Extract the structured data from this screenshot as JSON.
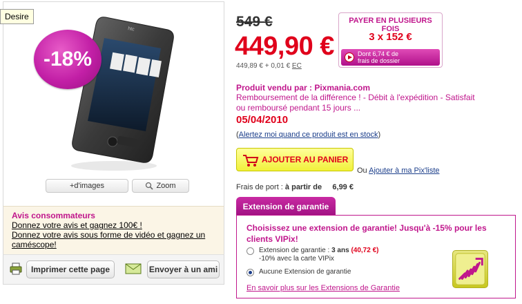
{
  "tooltip": "Desire",
  "product": {
    "discount_badge": "-18%",
    "more_images": "+d'images",
    "zoom": "Zoom"
  },
  "reviews": {
    "title": "Avis consommateurs",
    "link1": "Donnez votre avis et gagnez 100€ !",
    "link2": "Donnez votre avis sous forme de vidéo et gagnez un caméscope!"
  },
  "actions": {
    "print": "Imprimer cette page",
    "send_friend": "Envoyer à un ami"
  },
  "pricing": {
    "old_price": "549 €",
    "price": "449,90 €",
    "detail": "449,89 € + 0,01 €",
    "detail_link": "EC"
  },
  "installments": {
    "title": "PAYER EN PLUSIEURS FOIS",
    "value": "3 x 152 €",
    "fee_line1": "Dont 6,74 € de",
    "fee_line2": "frais de dossier"
  },
  "seller": {
    "label": "Produit vendu par : Pixmania.com",
    "refund": "Remboursement de la différence ! - Débit à l'expédition - Satisfait ou remboursé pendant 15 jours ...",
    "date": "05/04/2010",
    "alert_open": "(",
    "alert_link": "Alertez moi quand ce produit est en stock",
    "alert_close": ")"
  },
  "cart": {
    "add_label": "AJOUTER AU PANIER",
    "or": "Ou ",
    "wishlist": "Ajouter à ma Pix'liste"
  },
  "shipping": {
    "label": "Frais de port : ",
    "bold": "à partir de",
    "value": "6,99 €"
  },
  "warranty": {
    "tab": "Extension de garantie",
    "heading": "Choisissez une extension de garantie! Jusqu'à -15% pour les clients VIPix!",
    "opt1_label": "Extension de garantie : ",
    "opt1_duration": "3 ans",
    "opt1_price": "(40,72 €)",
    "opt1_note": "-10% avec la carte VIPix",
    "opt1_selected": false,
    "opt2_label": "Aucune Extension de garantie",
    "opt2_selected": true,
    "link": "En savoir plus sur les Extensions de Garantie"
  },
  "colors": {
    "accent_pink": "#c0168c",
    "price_red": "#e0001b",
    "cart_yellow": "#f1f13a"
  }
}
